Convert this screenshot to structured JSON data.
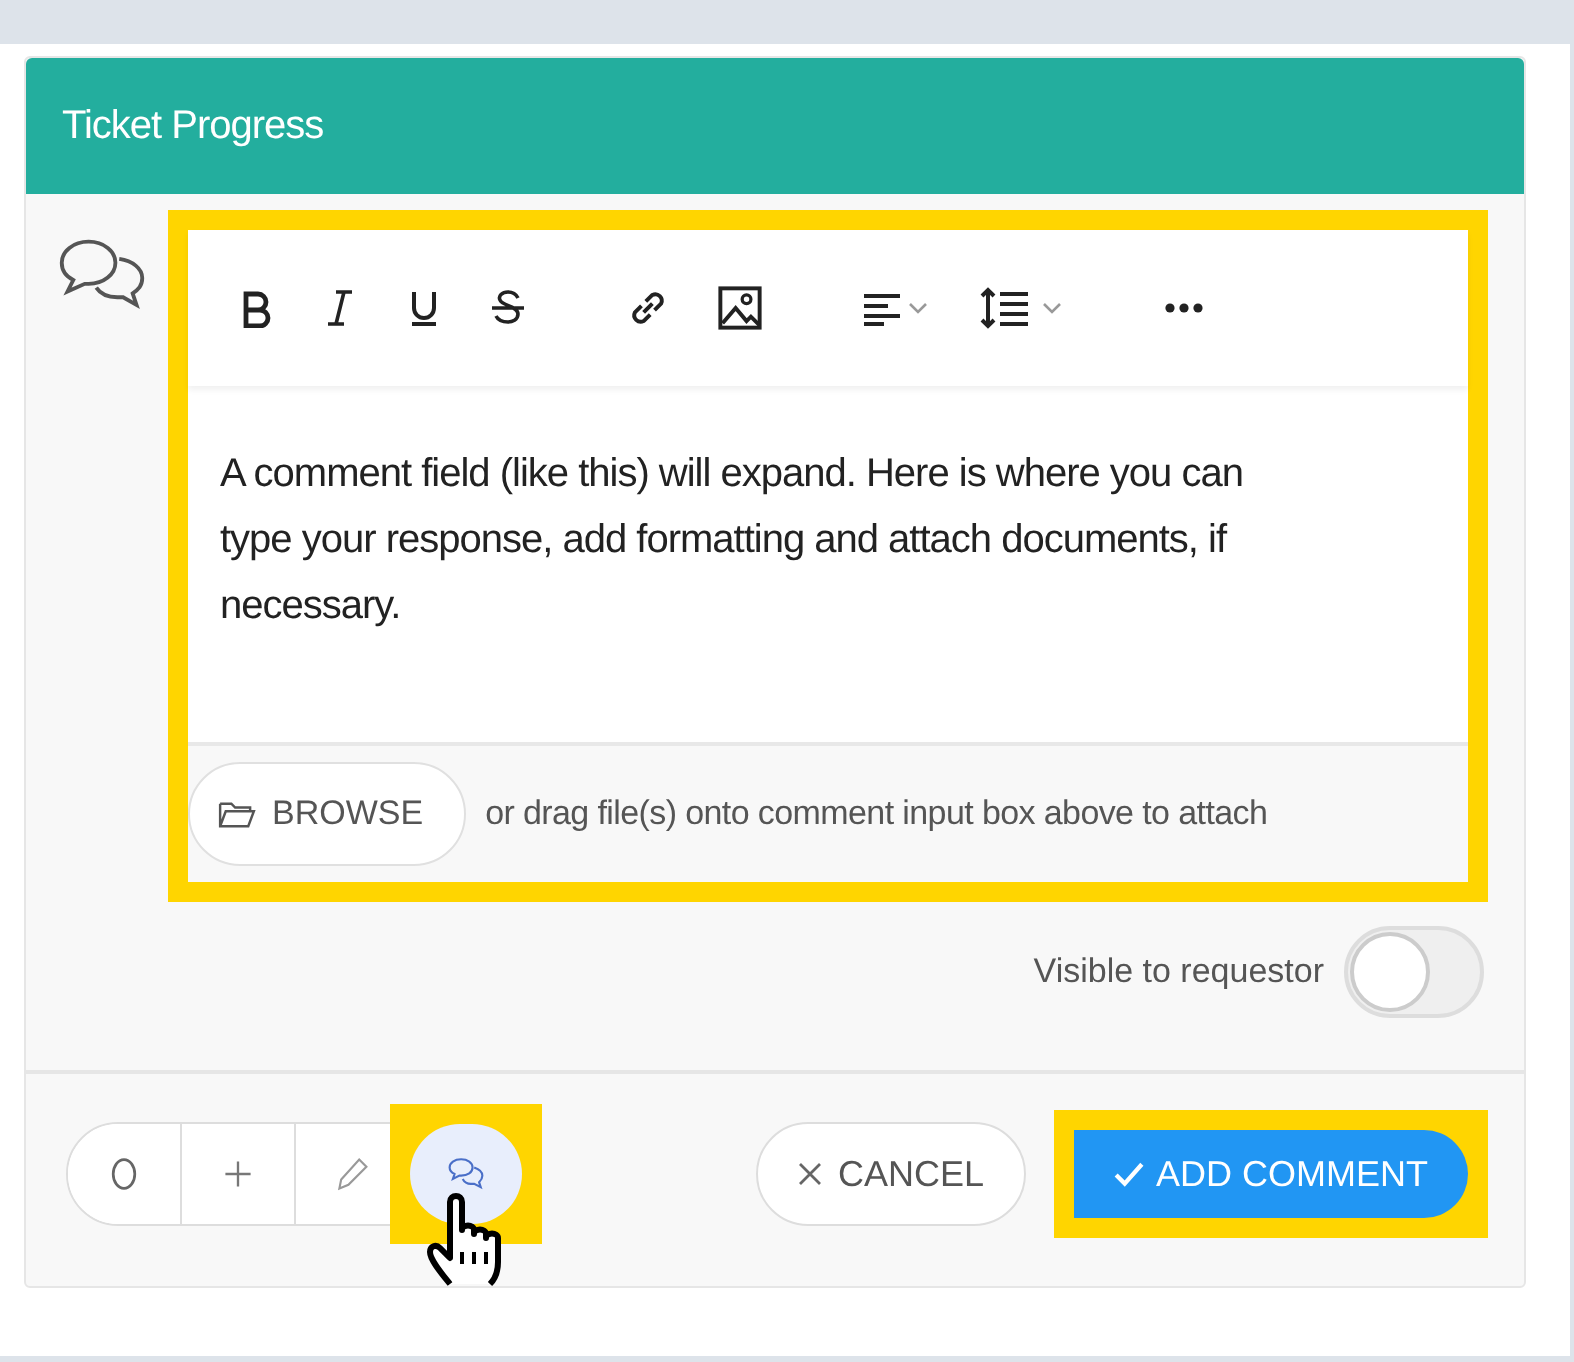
{
  "header": {
    "title": "Ticket Progress"
  },
  "editor": {
    "toolbar": [
      {
        "kind": "bold"
      },
      {
        "kind": "italic"
      },
      {
        "kind": "underline"
      },
      {
        "kind": "strike"
      },
      {
        "kind": "link"
      },
      {
        "kind": "image"
      },
      {
        "kind": "align"
      },
      {
        "kind": "spacing"
      },
      {
        "kind": "more"
      }
    ],
    "text": "A comment field (like this) will expand.  Here is where you can type your response, add formatting and attach documents, if necessary.",
    "browse_label": "BROWSE",
    "attach_hint": "or drag file(s) onto comment input box above to attach",
    "highlighted": true
  },
  "visibility": {
    "label": "Visible to requestor",
    "on": false
  },
  "actions": [
    {
      "kind": "circle",
      "selected": false,
      "highlighted": false
    },
    {
      "kind": "plus",
      "selected": false,
      "highlighted": false
    },
    {
      "kind": "pencil",
      "selected": false,
      "highlighted": false
    },
    {
      "kind": "comment",
      "selected": true,
      "highlighted": true
    }
  ],
  "cancel": {
    "label": "CANCEL"
  },
  "submit": {
    "label": "ADD COMMENT",
    "highlighted": true
  }
}
